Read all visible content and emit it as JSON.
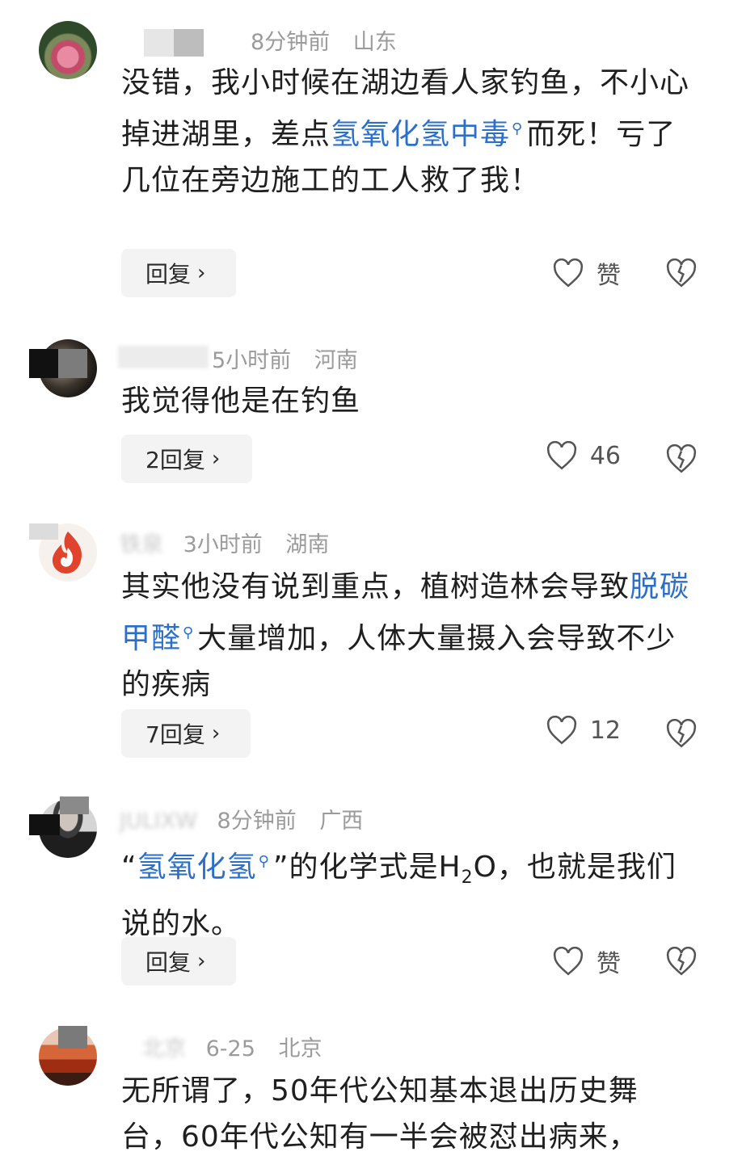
{
  "comments": [
    {
      "time": "8分钟前",
      "location": "山东",
      "text_before": "没错，我小时候在湖边看人家钓鱼，不小心掉进湖里，差点",
      "link": "氢氧化氢中毒",
      "text_after": "而死！亏了几位在旁边施工的工人救了我！",
      "reply_label": "回复",
      "like_label": "赞"
    },
    {
      "time": "5小时前",
      "location": "河南",
      "text": "我觉得他是在钓鱼",
      "reply_label": "2回复",
      "like_label": "46"
    },
    {
      "name": "铁泉",
      "time": "3小时前",
      "location": "湖南",
      "text_before": "其实他没有说到重点，植树造林会导致",
      "link": "脱碳甲醛",
      "text_after": "大量增加，人体大量摄入会导致不少的疾病",
      "reply_label": "7回复",
      "like_label": "12"
    },
    {
      "name": "JULIXW",
      "time": "8分钟前",
      "location": "广西",
      "quote_open": "“",
      "link": "氢氧化氢",
      "quote_close": "”",
      "text_mid": "的化学式是H",
      "subscript": "2",
      "text_after": "O，也就是我们说的水。",
      "reply_label": "回复",
      "like_label": "赞"
    },
    {
      "name": "北京",
      "time": "6-25",
      "location": "北京",
      "text": "无所谓了，50年代公知基本退出历史舞台，60年代公知有一半会被怼出病来，"
    }
  ],
  "icons": {
    "search_mark": "search-icon",
    "like": "heart-outline-icon",
    "dislike": "broken-heart-icon",
    "chevron": "chevron-right-icon"
  },
  "colors": {
    "link": "#2b6fc9",
    "meta": "#9b9b9b",
    "reply_bg": "#f3f3f3"
  }
}
